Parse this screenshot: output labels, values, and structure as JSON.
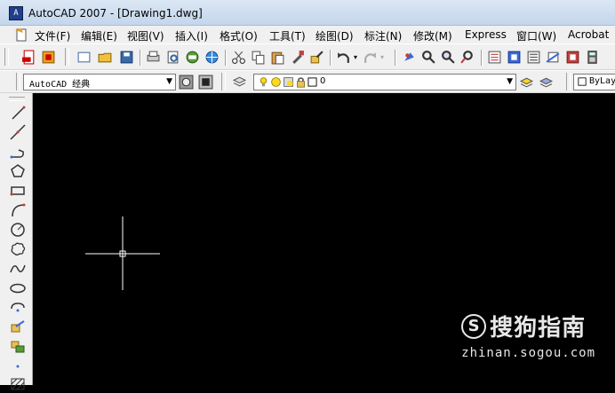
{
  "window": {
    "title": "AutoCAD 2007 - [Drawing1.dwg]",
    "app_icon": "autocad-app-icon"
  },
  "menu": {
    "items": [
      "文件(F)",
      "编辑(E)",
      "视图(V)",
      "插入(I)",
      "格式(O)",
      "工具(T)",
      "绘图(D)",
      "标注(N)",
      "修改(M)",
      "Express",
      "窗口(W)",
      "Acrobat"
    ]
  },
  "workspace": {
    "selected": "AutoCAD 经典"
  },
  "layer": {
    "current": "0"
  },
  "color": {
    "current": "ByLay"
  },
  "watermark": {
    "logo": "S",
    "brand": "搜狗指南",
    "url": "zhinan.sogou.com"
  },
  "colors": {
    "canvas": "#000000",
    "crosshair": "#ffffff",
    "toolbar": "#f0f0f0"
  }
}
